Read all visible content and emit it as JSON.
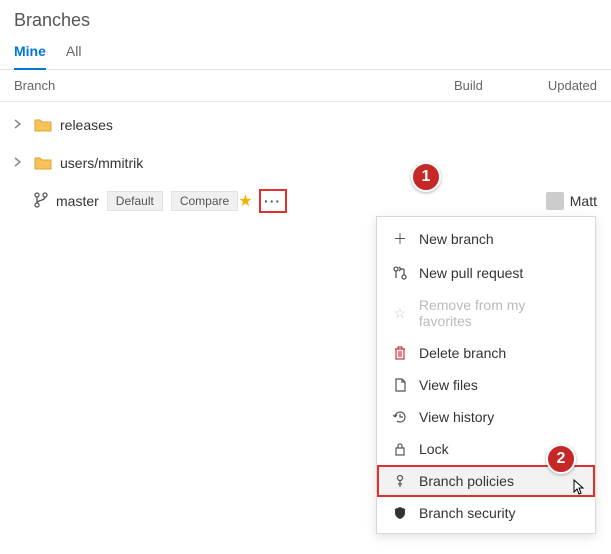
{
  "title": "Branches",
  "tabs": {
    "mine": "Mine",
    "all": "All"
  },
  "columns": {
    "branch": "Branch",
    "build": "Build",
    "updated": "Updated"
  },
  "folders": [
    {
      "name": "releases"
    },
    {
      "name": "users/mmitrik"
    }
  ],
  "branch": {
    "name": "master",
    "badges": {
      "default": "Default",
      "compare": "Compare"
    },
    "updated_by": "Matt"
  },
  "menu": {
    "new_branch": "New branch",
    "new_pr": "New pull request",
    "remove_fav": "Remove from my favorites",
    "delete": "Delete branch",
    "view_files": "View files",
    "view_history": "View history",
    "lock": "Lock",
    "policies": "Branch policies",
    "security": "Branch security"
  },
  "callouts": {
    "one": "1",
    "two": "2"
  }
}
